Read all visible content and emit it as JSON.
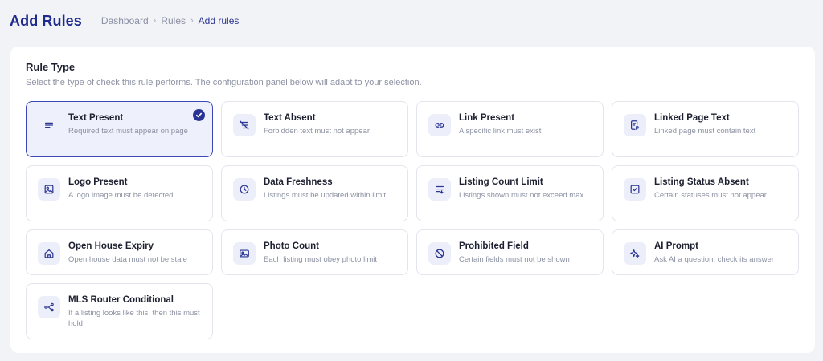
{
  "header": {
    "title": "Add Rules",
    "breadcrumb": [
      "Dashboard",
      "Rules",
      "Add rules"
    ]
  },
  "rule_type": {
    "title": "Rule Type",
    "description": "Select the type of check this rule performs. The configuration panel below will adapt to your selection.",
    "selected": "Text Present",
    "cards": [
      {
        "title": "Text Present",
        "desc": "Required text must appear on page",
        "icon": "text-lines-icon"
      },
      {
        "title": "Text Absent",
        "desc": "Forbidden text must not appear",
        "icon": "text-strikethrough-icon"
      },
      {
        "title": "Link Present",
        "desc": "A specific link must exist",
        "icon": "link-icon"
      },
      {
        "title": "Linked Page Text",
        "desc": "Linked page must contain text",
        "icon": "document-link-icon"
      },
      {
        "title": "Logo Present",
        "desc": "A logo image must be detected",
        "icon": "image-icon"
      },
      {
        "title": "Data Freshness",
        "desc": "Listings must be updated within limit",
        "icon": "clock-icon"
      },
      {
        "title": "Listing Count Limit",
        "desc": "Listings shown must not exceed max",
        "icon": "list-limit-icon"
      },
      {
        "title": "Listing Status Absent",
        "desc": "Certain statuses must not appear",
        "icon": "checkbox-icon"
      },
      {
        "title": "Open House Expiry",
        "desc": "Open house data must not be stale",
        "icon": "house-icon"
      },
      {
        "title": "Photo Count",
        "desc": "Each listing must obey photo limit",
        "icon": "photo-icon"
      },
      {
        "title": "Prohibited Field",
        "desc": "Certain fields must not be shown",
        "icon": "prohibited-icon"
      },
      {
        "title": "AI Prompt",
        "desc": "Ask AI a question, check its answer",
        "icon": "sparkle-icon"
      },
      {
        "title": "MLS Router Conditional",
        "desc": "If a listing looks like this, then this must hold",
        "icon": "router-branch-icon"
      }
    ]
  },
  "colors": {
    "accent": "#2a3494",
    "selected_bg": "#eef0fc",
    "title": "#1e2a8c"
  }
}
